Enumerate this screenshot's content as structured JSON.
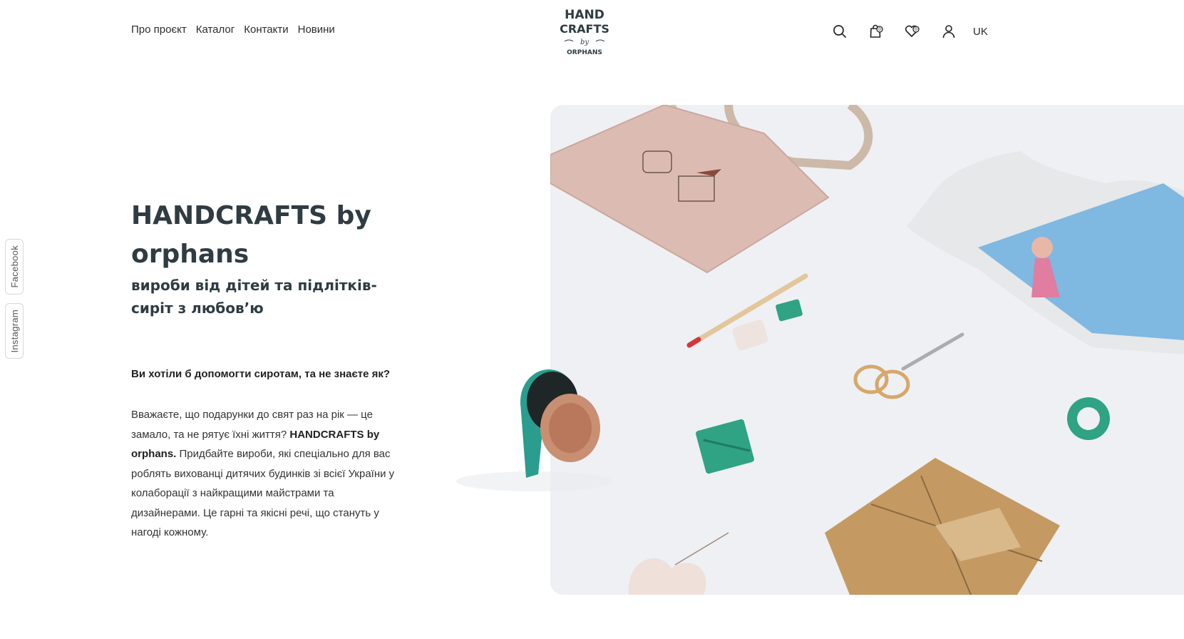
{
  "nav": {
    "items": [
      "Про проєкт",
      "Каталог",
      "Контакти",
      "Новини"
    ]
  },
  "logo": {
    "line1": "HAND",
    "line2": "CRAFTS",
    "line3": "by",
    "line4": "ORPHANS"
  },
  "header": {
    "icons": [
      "search-icon",
      "cart-icon",
      "wishlist-icon",
      "user-icon"
    ],
    "lang": "UK",
    "cart_count": "0",
    "wishlist_count": "0"
  },
  "social": {
    "facebook": "Facebook",
    "instagram": "Instagram"
  },
  "hero": {
    "title": "HANDCRAFTS by orphans",
    "subtitle": "вироби від дітей та підлітків-сиріт з любов’ю",
    "question": "Ви хотіли б допомогти сиротам, та не знаєте як?",
    "body_intro": "Вважаєте, що подарунки до свят раз на рік — це замало, та не рятує їхні життя? ",
    "body_bold": "HANDCRAFTS by orphans.",
    "body_rest": " Придбайте вироби, які спеціально для вас роблять вихованці дитячих будинків зі всієї України у колаборації з найкращими майстрами та дизайнерами. Це гарні та якісні речі, що стануть у нагоді кожному."
  },
  "colors": {
    "heading": "#2f3c42",
    "accent_teal": "#2a9d8f",
    "image_bg": "#eef0f4",
    "craft_paper": "#c49a62"
  }
}
